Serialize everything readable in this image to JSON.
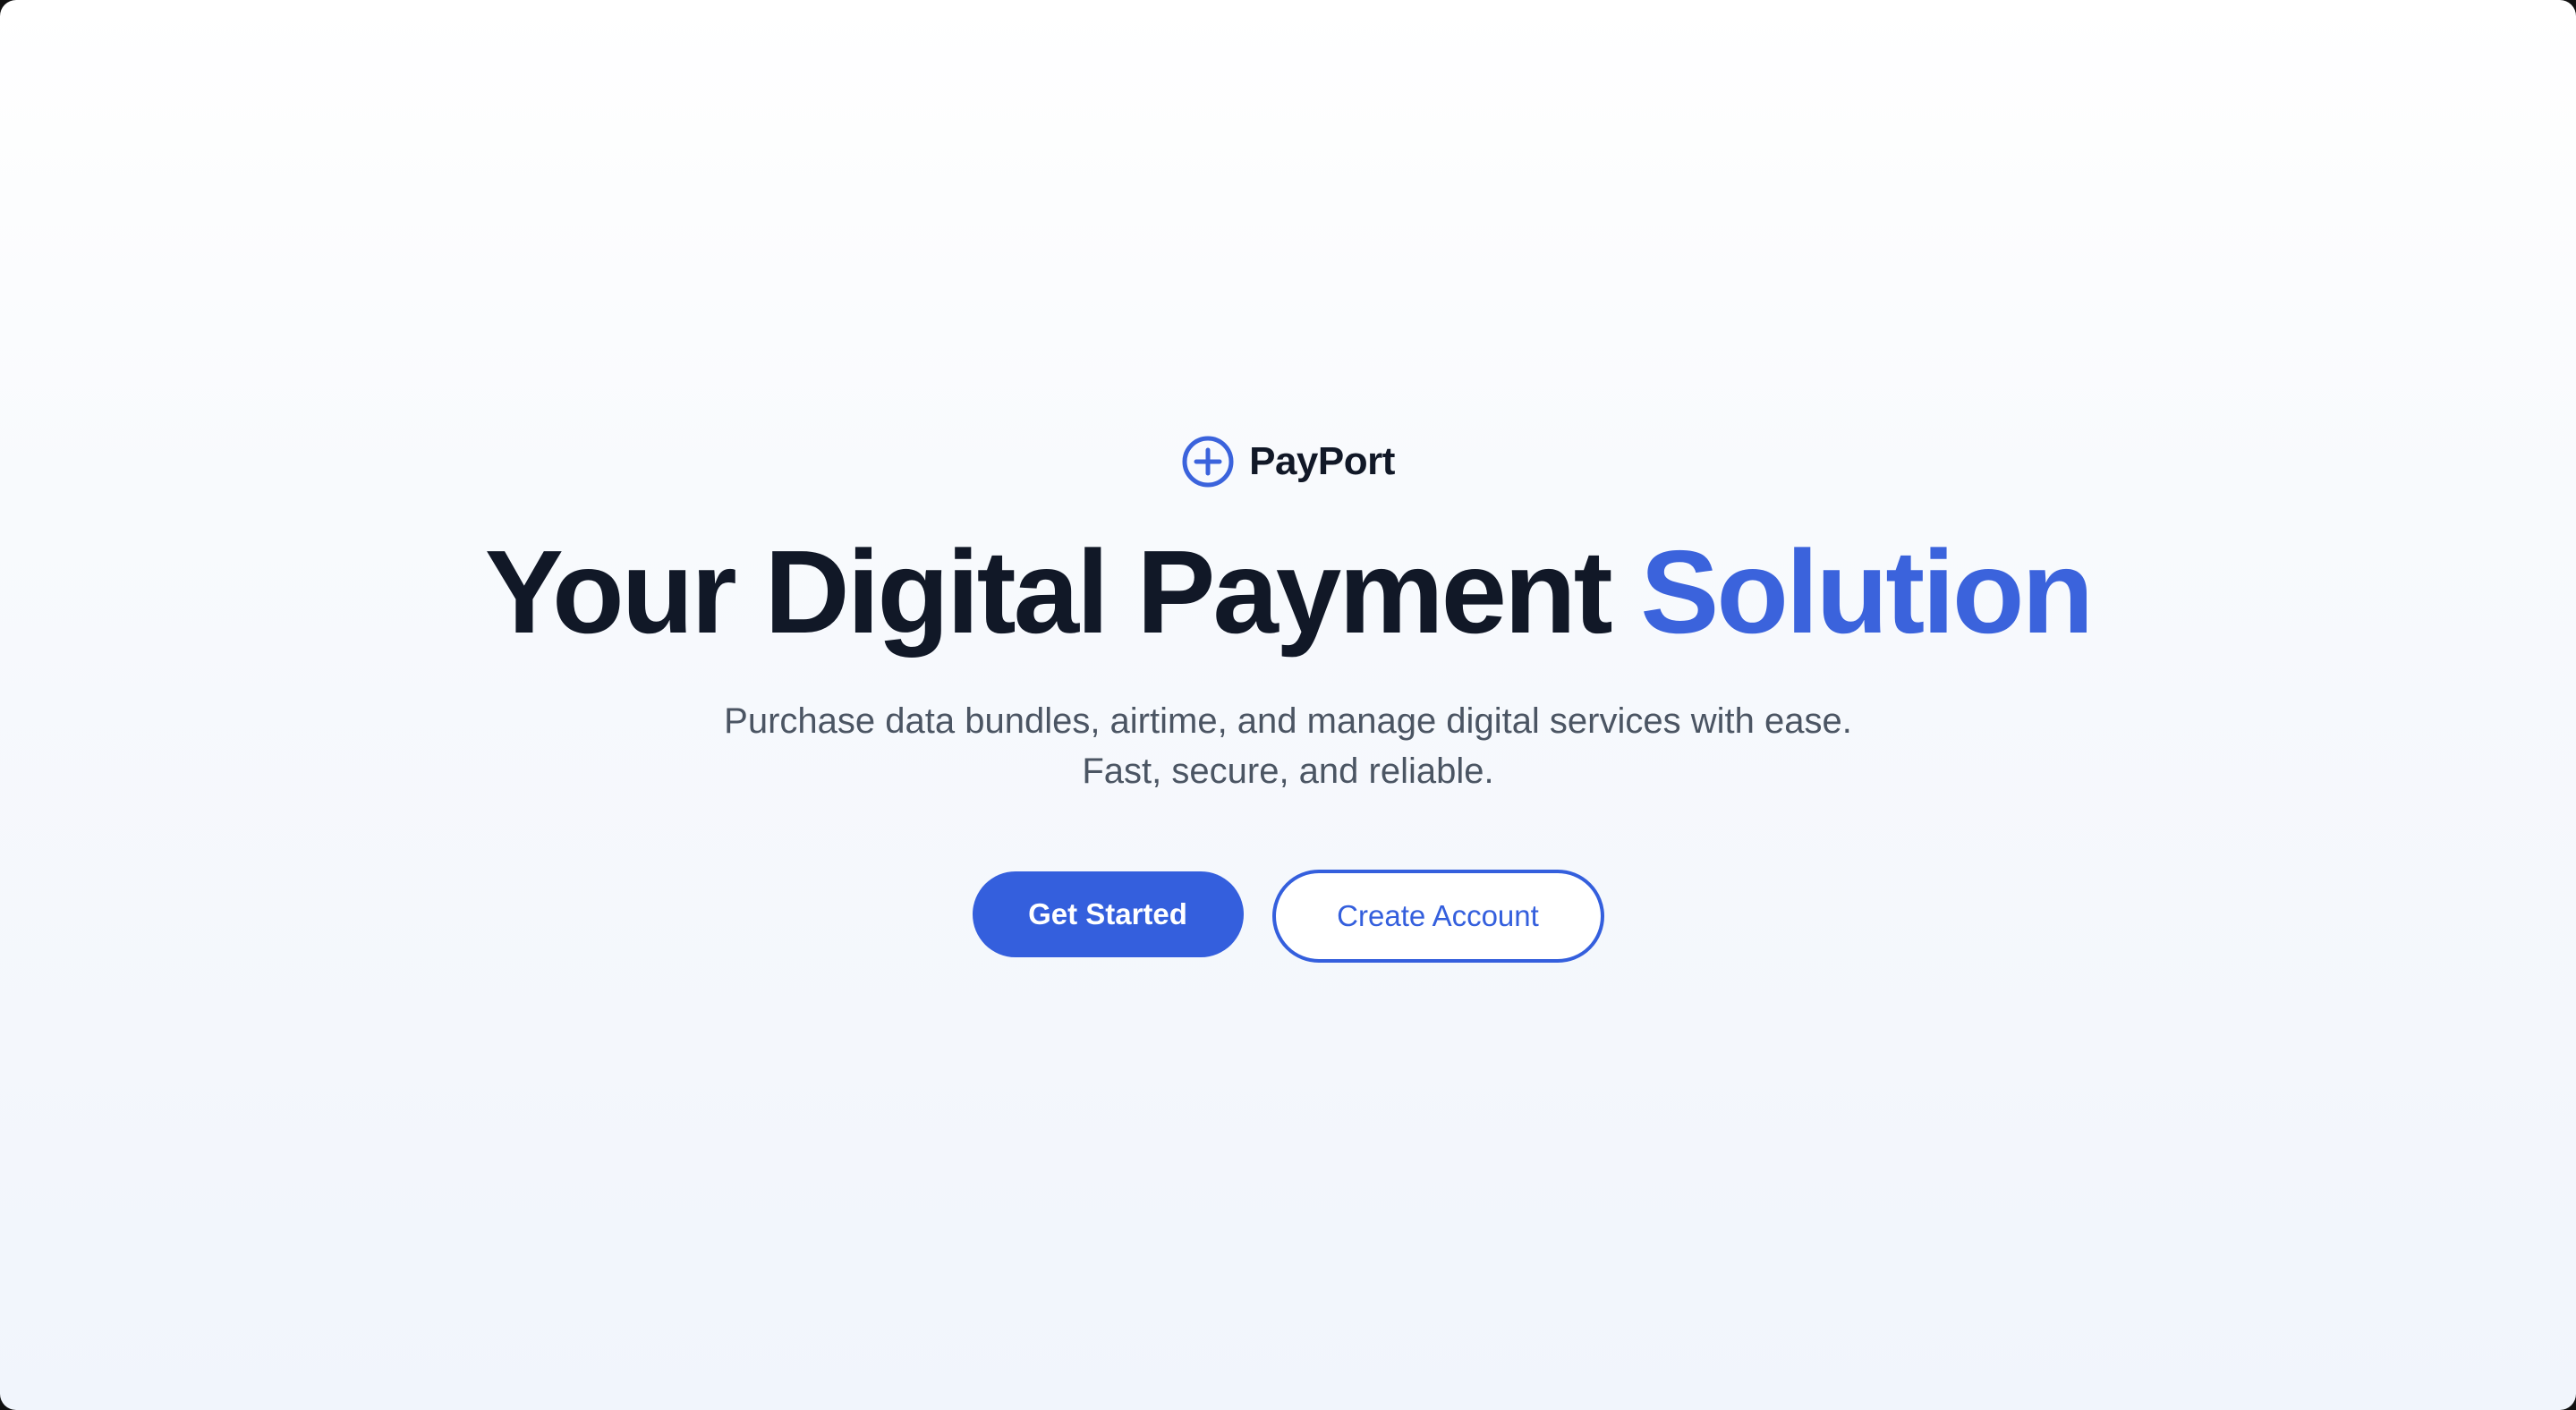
{
  "brand": {
    "name": "PayPort",
    "icon": "plus-circle-icon",
    "accent_color": "#3b63dc"
  },
  "hero": {
    "title_main": "Your Digital Payment ",
    "title_accent": "Solution",
    "subtitle_line1": "Purchase data bundles, airtime, and manage digital services with ease.",
    "subtitle_line2": "Fast, secure, and reliable."
  },
  "actions": {
    "primary_label": "Get Started",
    "secondary_label": "Create Account",
    "primary_color": "#345fdd"
  }
}
